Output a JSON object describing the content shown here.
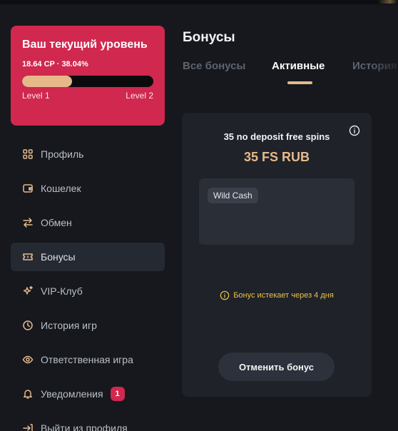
{
  "level_card": {
    "title": "Ваш текущий уровень",
    "progress_text": "18.64 CP · 38.04%",
    "progress_fraction": 0.3804,
    "current_level": "Level 1",
    "next_level": "Level 2"
  },
  "sidebar": {
    "items": [
      {
        "label": "Профиль",
        "icon": "grid-icon"
      },
      {
        "label": "Кошелек",
        "icon": "wallet-icon"
      },
      {
        "label": "Обмен",
        "icon": "exchange-icon"
      },
      {
        "label": "Бонусы",
        "icon": "ticket-icon",
        "active": true
      },
      {
        "label": "VIP-Клуб",
        "icon": "sparkles-icon"
      },
      {
        "label": "История игр",
        "icon": "clock-icon"
      },
      {
        "label": "Ответственная игра",
        "icon": "eye-icon"
      },
      {
        "label": "Уведомления",
        "icon": "bell-icon",
        "badge": "1"
      },
      {
        "label": "Выйти из профиля",
        "icon": "logout-icon"
      }
    ]
  },
  "main": {
    "title": "Бонусы",
    "tabs": [
      {
        "label": "Все бонусы"
      },
      {
        "label": "Активные",
        "active": true
      },
      {
        "label": "История"
      }
    ]
  },
  "bonus": {
    "name": "35 no deposit free spins",
    "amount": "35 FS RUB",
    "games": [
      "Wild Cash"
    ],
    "expiry": "Бонус истекает через 4 дня",
    "cancel_label": "Отменить бонус"
  },
  "colors": {
    "accent": "#e7b98a",
    "level_card": "#d0284f",
    "badge": "#d0284f",
    "warning": "#e9c24a",
    "background": "#16181d",
    "card": "#1f2229"
  }
}
